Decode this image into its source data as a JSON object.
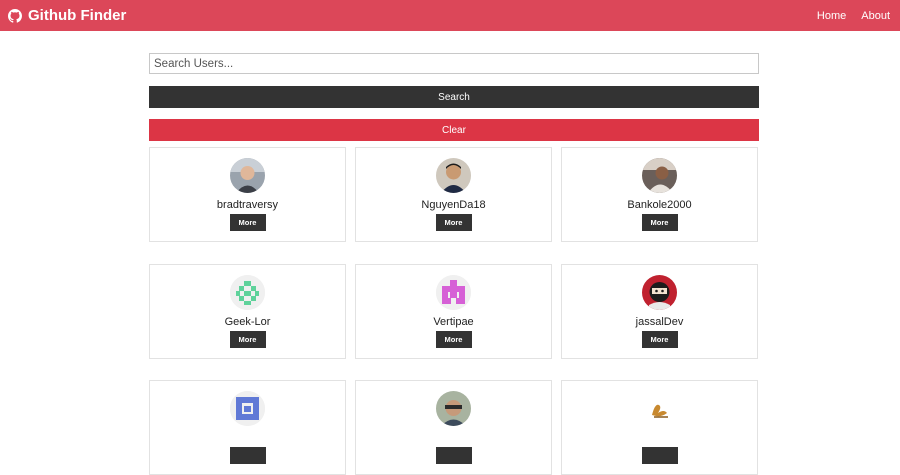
{
  "navbar": {
    "brand": "Github Finder",
    "links": [
      "Home",
      "About"
    ],
    "color": "#dc4759",
    "brand_icon": "github-icon"
  },
  "search": {
    "placeholder": "Search Users...",
    "value": "",
    "search_label": "Search",
    "clear_label": "Clear"
  },
  "users": [
    {
      "login": "bradtraversy",
      "more": "More",
      "avatar": "photo"
    },
    {
      "login": "NguyenDa18",
      "more": "More",
      "avatar": "photo"
    },
    {
      "login": "Bankole2000",
      "more": "More",
      "avatar": "photo"
    },
    {
      "login": "Geek-Lor",
      "more": "More",
      "avatar": "identicon-green"
    },
    {
      "login": "Vertipae",
      "more": "More",
      "avatar": "identicon-magenta"
    },
    {
      "login": "jassalDev",
      "more": "More",
      "avatar": "ninja"
    },
    {
      "login": "",
      "more": "",
      "avatar": "identicon-blue"
    },
    {
      "login": "",
      "more": "",
      "avatar": "photo"
    },
    {
      "login": "",
      "more": "",
      "avatar": "logo"
    }
  ]
}
